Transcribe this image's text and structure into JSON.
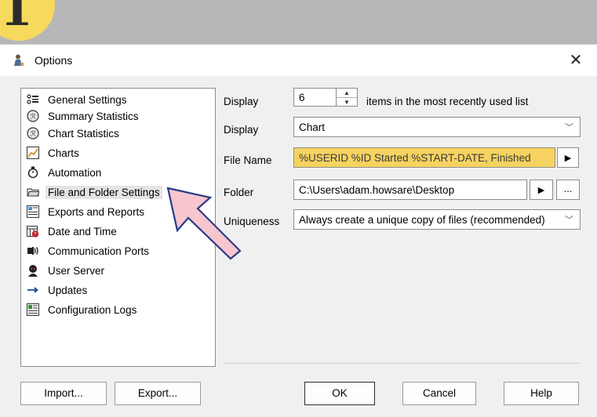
{
  "step_badge": "1",
  "dialog": {
    "title": "Options",
    "close_glyph": "✕"
  },
  "tree": [
    {
      "label": "General Settings",
      "icon": "general-settings-icon"
    },
    {
      "label": "Summary Statistics",
      "icon": "summary-statistics-icon"
    },
    {
      "label": "Chart Statistics",
      "icon": "chart-statistics-icon"
    },
    {
      "label": "Charts",
      "icon": "charts-icon"
    },
    {
      "label": "Automation",
      "icon": "automation-icon"
    },
    {
      "label": "File and Folder Settings",
      "icon": "folder-icon",
      "selected": true
    },
    {
      "label": "Exports and Reports",
      "icon": "exports-icon"
    },
    {
      "label": "Date and Time",
      "icon": "calendar-icon"
    },
    {
      "label": "Communication Ports",
      "icon": "port-icon"
    },
    {
      "label": "User Server",
      "icon": "user-server-icon"
    },
    {
      "label": "Updates",
      "icon": "arrow-right-icon"
    },
    {
      "label": "Configuration Logs",
      "icon": "log-icon"
    }
  ],
  "form": {
    "display1_label": "Display",
    "display1_value": "6",
    "display1_suffix": "items in the most recently used list",
    "display2_label": "Display",
    "display2_value": "Chart",
    "filename_label": "File Name",
    "filename_value": "%USERID %ID Started %START-DATE, Finished",
    "folder_label": "Folder",
    "folder_value": "C:\\Users\\adam.howsare\\Desktop",
    "browse_label": "...",
    "uniqueness_label": "Uniqueness",
    "uniqueness_value": "Always create a unique copy of files (recommended)"
  },
  "buttons": {
    "import": "Import...",
    "export": "Export...",
    "ok": "OK",
    "cancel": "Cancel",
    "help": "Help"
  },
  "colors": {
    "highlight_yellow": "#f6d360",
    "pointer_pink": "#f7c6ce",
    "badge_yellow": "#f6d95d"
  }
}
